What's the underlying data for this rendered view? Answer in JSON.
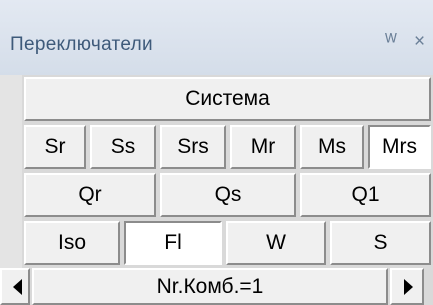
{
  "title": "Переключатели",
  "title_buttons": {
    "pin": "Ȅ",
    "close": "×"
  },
  "system_button": "Система",
  "row1": [
    "Sr",
    "Ss",
    "Srs",
    "Mr",
    "Ms",
    "Mrs"
  ],
  "row2": [
    "Qr",
    "Qs",
    "Q1"
  ],
  "row3": [
    "Iso",
    "Fl",
    "W",
    "S"
  ],
  "active": [
    "Mrs",
    "Fl"
  ],
  "status": "Nr.Комб.=1",
  "icons": {
    "prev": "scroll-left-icon",
    "next": "scroll-right-icon"
  }
}
